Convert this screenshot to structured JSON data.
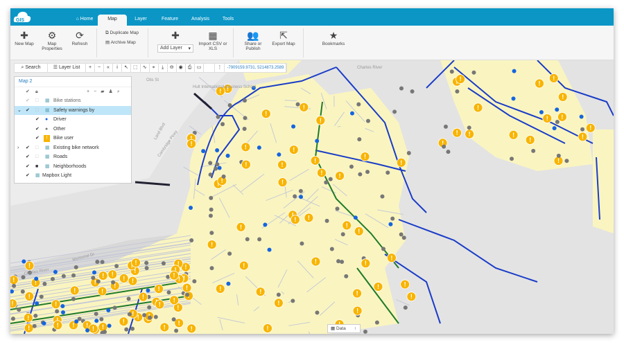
{
  "app": {
    "logo": "GIS"
  },
  "tabs": [
    {
      "label": "Home",
      "icon": "home-icon"
    },
    {
      "label": "Map",
      "active": true
    },
    {
      "label": "Layer"
    },
    {
      "label": "Feature"
    },
    {
      "label": "Analysis"
    },
    {
      "label": "Tools"
    }
  ],
  "ribbon": {
    "new_map": "New Map",
    "map_properties": "Map Properties",
    "refresh": "Refresh",
    "duplicate_map": "Duplicate Map",
    "archive_map": "Archive Map",
    "add_layer": "Add Layer",
    "import_csv": "Import CSV or XLS",
    "share": "Share or Publish",
    "export_map": "Export Map",
    "bookmarks": "Bookmarks"
  },
  "toolbar": {
    "search": "Search",
    "layer_list": "Layer List",
    "coordinates": "-7909159.9731, 5214873.2589"
  },
  "layers": {
    "map_name": "Map 2",
    "items": [
      {
        "label": "Bike stations",
        "visible": true,
        "locked": false,
        "dim": true
      },
      {
        "label": "Safety warnings by",
        "visible": true,
        "locked": false,
        "selected": true,
        "expanded": true
      },
      {
        "label": "Driver",
        "sub": true,
        "color": "#1565e0"
      },
      {
        "label": "Other",
        "sub": true,
        "color": "#777777"
      },
      {
        "label": "Bike user",
        "sub": true,
        "color": "#f8b400"
      },
      {
        "label": "Existing bike network",
        "visible": true,
        "collapsed": true
      },
      {
        "label": "Roads",
        "visible": true
      },
      {
        "label": "Neighborhoods",
        "visible": true,
        "locked": true
      },
      {
        "label": "Mapbox Light",
        "visible": true
      }
    ]
  },
  "map_labels": {
    "hult": "Hult International Business School",
    "land": "Land Blvd",
    "cambridge": "Cambridge Pkwy",
    "otis": "Otis St",
    "charles": "Charles River",
    "charles2": "Charles River",
    "memorial": "Memorial Dr"
  },
  "data_button": "Data",
  "colors": {
    "header": "#0b96c6",
    "neighborhood": "#faf5c0",
    "bike_network": "#1a3cc8",
    "warning": "#f8b400",
    "driver": "#1565e0",
    "other": "#777777"
  }
}
